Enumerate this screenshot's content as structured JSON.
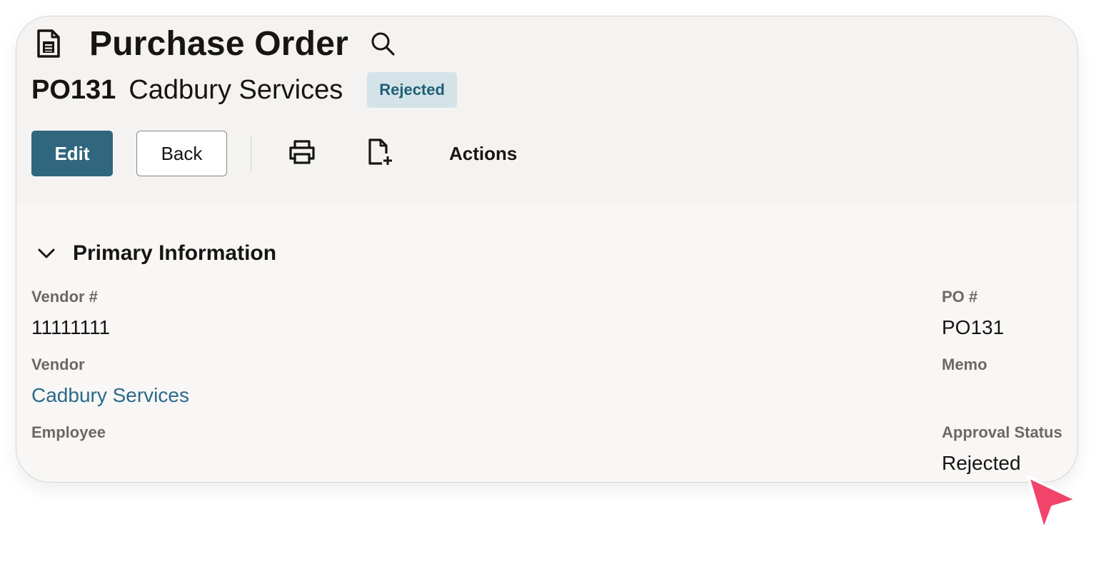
{
  "header": {
    "page_title": "Purchase Order",
    "record_id": "PO131",
    "record_name": "Cadbury Services",
    "status_badge": "Rejected"
  },
  "toolbar": {
    "edit_label": "Edit",
    "back_label": "Back",
    "print_icon": "print-icon",
    "new_document_icon": "new-document-icon",
    "actions_label": "Actions"
  },
  "section": {
    "title": "Primary Information",
    "expanded": true
  },
  "fields": {
    "vendor_number_label": "Vendor #",
    "vendor_number_value": "11111111",
    "vendor_label": "Vendor",
    "vendor_value": "Cadbury Services",
    "employee_label": "Employee",
    "po_number_label": "PO #",
    "po_number_value": "PO131",
    "memo_label": "Memo",
    "approval_status_label": "Approval Status",
    "approval_status_value": "Rejected"
  },
  "colors": {
    "primary_button": "#30677f",
    "badge_background": "#d4e3e8",
    "badge_text": "#1f5f78",
    "link": "#2b6a89",
    "cursor": "#f2436a"
  }
}
